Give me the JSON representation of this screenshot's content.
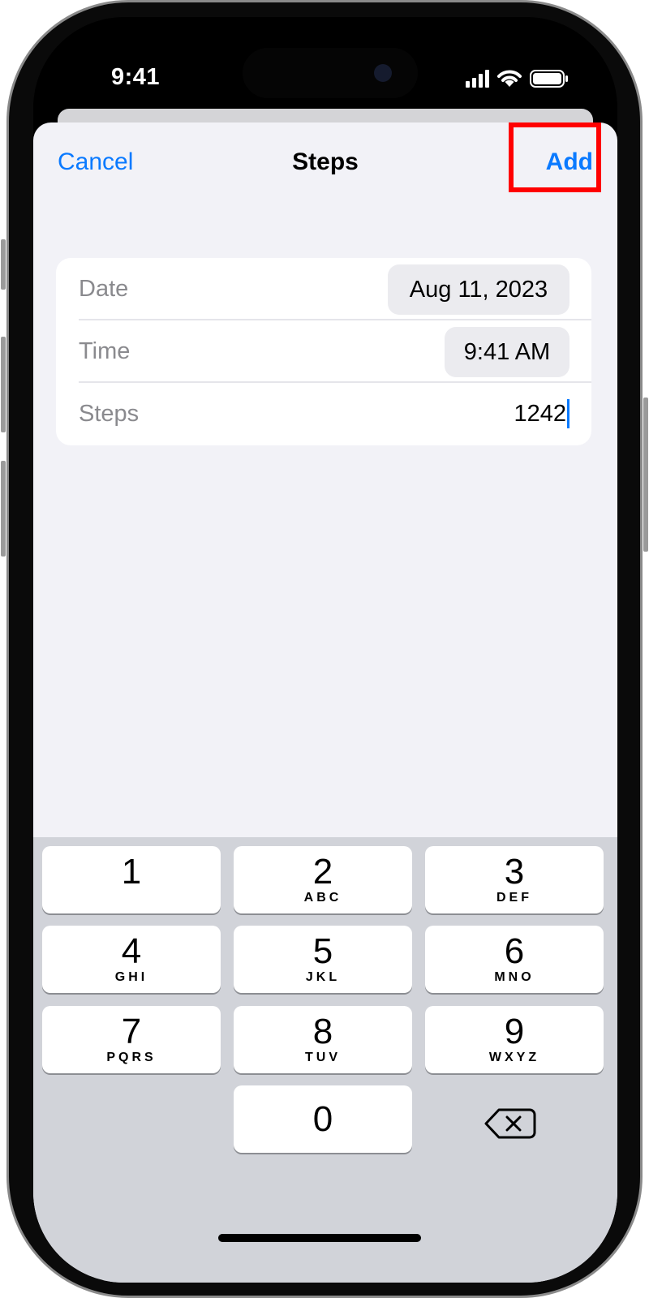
{
  "status_bar": {
    "time": "9:41"
  },
  "nav": {
    "cancel_label": "Cancel",
    "title": "Steps",
    "add_label": "Add"
  },
  "form": {
    "date": {
      "label": "Date",
      "value": "Aug 11, 2023"
    },
    "time": {
      "label": "Time",
      "value": "9:41 AM"
    },
    "steps": {
      "label": "Steps",
      "value": "1242"
    }
  },
  "keypad": {
    "keys": [
      {
        "number": "1",
        "letters": ""
      },
      {
        "number": "2",
        "letters": "ABC"
      },
      {
        "number": "3",
        "letters": "DEF"
      },
      {
        "number": "4",
        "letters": "GHI"
      },
      {
        "number": "5",
        "letters": "JKL"
      },
      {
        "number": "6",
        "letters": "MNO"
      },
      {
        "number": "7",
        "letters": "PQRS"
      },
      {
        "number": "8",
        "letters": "TUV"
      },
      {
        "number": "9",
        "letters": "WXYZ"
      },
      {
        "number": "0",
        "letters": ""
      }
    ],
    "delete_icon": "delete-backspace-icon"
  },
  "colors": {
    "accent": "#0a7aff",
    "sheet_bg": "#f2f2f7",
    "keypad_bg": "#d1d3d9",
    "highlight": "#ff0000"
  }
}
